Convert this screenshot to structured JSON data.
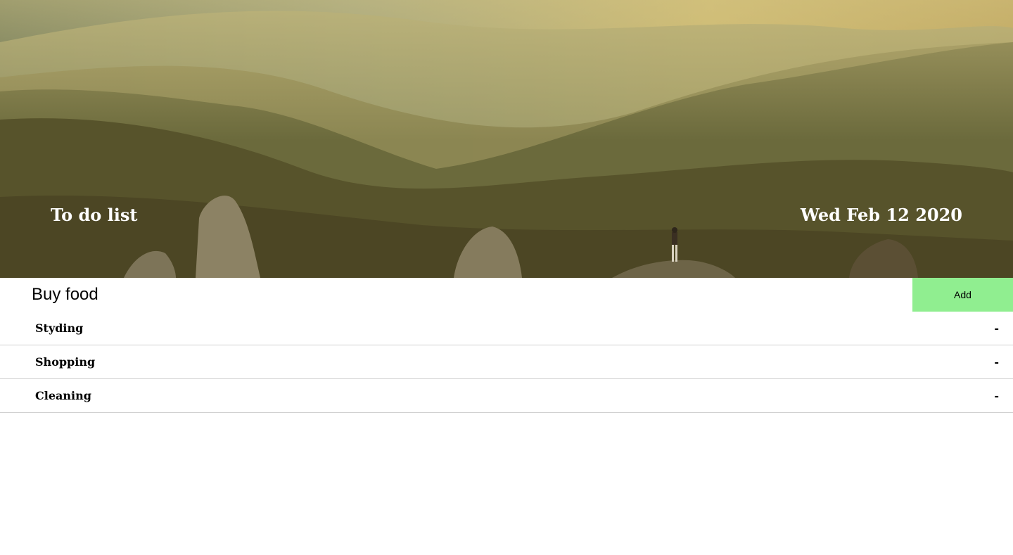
{
  "header": {
    "title": "To do list",
    "date": "Wed Feb 12 2020"
  },
  "new_task": {
    "value": "Buy food",
    "add_label": "Add"
  },
  "tasks": [
    {
      "label": "Styding",
      "remove_label": "-"
    },
    {
      "label": "Shopping",
      "remove_label": "-"
    },
    {
      "label": "Cleaning",
      "remove_label": "-"
    }
  ],
  "colors": {
    "add_button": "#90ee90",
    "divider": "#d0d0d0"
  }
}
